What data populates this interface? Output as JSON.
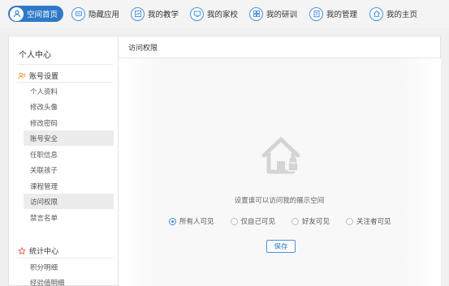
{
  "topnav": {
    "items": [
      {
        "label": "空间首页",
        "icon": "person-icon",
        "active": true
      },
      {
        "label": "隐藏应用",
        "icon": "app-icon",
        "active": false
      },
      {
        "label": "我的教学",
        "icon": "teaching-icon",
        "active": false
      },
      {
        "label": "我的家校",
        "icon": "monitor-icon",
        "active": false
      },
      {
        "label": "我的研训",
        "icon": "grid-icon",
        "active": false
      },
      {
        "label": "我的管理",
        "icon": "document-icon",
        "active": false
      },
      {
        "label": "我的主页",
        "icon": "home-icon",
        "active": false
      }
    ]
  },
  "sidebar": {
    "title": "个人中心",
    "groups": [
      {
        "label": "账号设置",
        "icon": "user-settings-icon",
        "items": [
          "个人资料",
          "修改头像",
          "修改密码",
          "账号安全",
          "任职信息",
          "关联孩子",
          "课程管理",
          "访问权限",
          "禁言名单"
        ]
      },
      {
        "label": "统计中心",
        "icon": "star-icon",
        "items": [
          "积分明细",
          "经验值明细"
        ]
      }
    ]
  },
  "main": {
    "header": "访问权限",
    "icon": "locked-house-icon",
    "message": "设置谁可以访问我的展示空间",
    "options": [
      {
        "label": "所有人可见",
        "selected": true
      },
      {
        "label": "仅自己可见",
        "selected": false
      },
      {
        "label": "好友可见",
        "selected": false
      },
      {
        "label": "关注者可见",
        "selected": false
      }
    ],
    "save_label": "保存"
  },
  "colors": {
    "accent": "#2f79c9",
    "highlight": "#ececec",
    "star": "#e05a4a",
    "settings": "#e8a23a"
  }
}
